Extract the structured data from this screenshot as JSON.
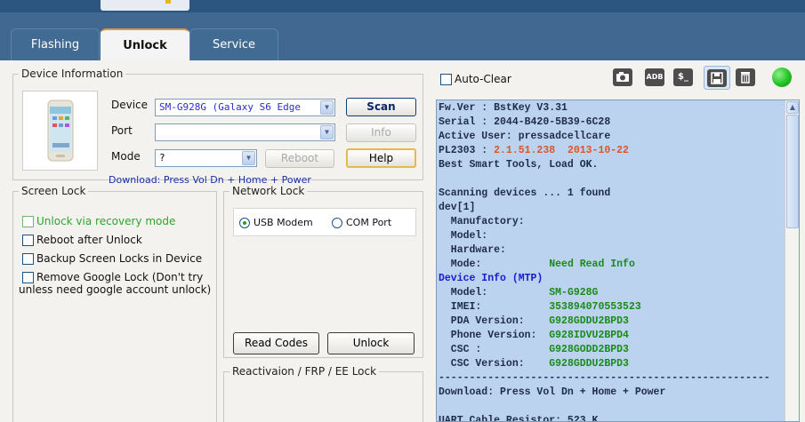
{
  "tabs": [
    {
      "label": "Flashing",
      "active": false
    },
    {
      "label": "Unlock",
      "active": true
    },
    {
      "label": "Service",
      "active": false
    }
  ],
  "device_info": {
    "legend": "Device Information",
    "device_label": "Device",
    "device_value": "SM-G928G  (Galaxy S6 Edge",
    "port_label": "Port",
    "port_value": "",
    "mode_label": "Mode",
    "mode_value": "?",
    "scan_label": "Scan",
    "info_label": "Info",
    "reboot_label": "Reboot",
    "help_label": "Help",
    "download_hint": "Download: Press Vol Dn + Home + Power"
  },
  "screen_lock": {
    "legend": "Screen Lock",
    "options": [
      {
        "label": "Unlock via recovery mode",
        "checked": false,
        "color": "#2ea52e"
      },
      {
        "label": "Reboot after Unlock",
        "checked": false
      },
      {
        "label": "Backup Screen Locks in Device",
        "checked": false
      },
      {
        "label": "Remove Google Lock (Don't try",
        "checked": false
      }
    ],
    "remove_google_note": "unless need google account unlock)"
  },
  "network_lock": {
    "legend": "Network Lock",
    "usb_modem_label": "USB Modem",
    "com_port_label": "COM Port",
    "selected": "USB Modem",
    "read_codes_label": "Read Codes",
    "unlock_label": "Unlock"
  },
  "reactivation": {
    "legend": "Reactivaion / FRP / EE Lock"
  },
  "toolbar": {
    "auto_clear_label": "Auto-Clear",
    "adb_label": "ADB",
    "shell_label": "$_",
    "status_color": "#22c322"
  },
  "log": [
    {
      "text": "Fw.Ver : BstKey V3.31",
      "color": "#1d2d4a"
    },
    {
      "text": "Serial : 2044-B420-5B39-6C28",
      "color": "#1d2d4a"
    },
    {
      "text": "Active User: pressadcellcare",
      "color": "#1d2d4a"
    },
    {
      "text": "PL2303 : ",
      "color": "#1d2d4a",
      "highlight": "2.1.51.238  2013-10-22",
      "highlight_color": "#e0532b"
    },
    {
      "text": "Best Smart Tools, Load OK.",
      "color": "#1d2d4a"
    },
    {
      "text": "",
      "color": "#1d2d4a"
    },
    {
      "text": "Scanning devices ... 1 found",
      "color": "#1d2d4a"
    },
    {
      "text": "dev[1]",
      "color": "#1d2d4a"
    },
    {
      "text": "  Manufactory:",
      "color": "#1d2d4a"
    },
    {
      "text": "  Model:",
      "color": "#1d2d4a"
    },
    {
      "text": "  Hardware:",
      "color": "#1d2d4a"
    },
    {
      "text": "  Mode:           ",
      "color": "#1d2d4a",
      "highlight": "Need Read Info",
      "highlight_color": "#1a8a1a"
    },
    {
      "text": "Device Info (MTP)",
      "color": "#1a1acf"
    },
    {
      "text": "  Model:          ",
      "color": "#1d2d4a",
      "highlight": "SM-G928G",
      "highlight_color": "#1a8a1a"
    },
    {
      "text": "  IMEI:           ",
      "color": "#1d2d4a",
      "highlight": "353894070553523",
      "highlight_color": "#1a8a1a"
    },
    {
      "text": "  PDA Version:    ",
      "color": "#1d2d4a",
      "highlight": "G928GDDU2BPD3",
      "highlight_color": "#1a8a1a"
    },
    {
      "text": "  Phone Version:  ",
      "color": "#1d2d4a",
      "highlight": "G928IDVU2BPD4",
      "highlight_color": "#1a8a1a"
    },
    {
      "text": "  CSC :           ",
      "color": "#1d2d4a",
      "highlight": "G928GODD2BPD3",
      "highlight_color": "#1a8a1a"
    },
    {
      "text": "  CSC Version:    ",
      "color": "#1d2d4a",
      "highlight": "G928GDDU2BPD3",
      "highlight_color": "#1a8a1a"
    },
    {
      "text": "------------------------------------------------------",
      "color": "#1d2d4a"
    },
    {
      "text": "Download: Press Vol Dn + Home + Power",
      "color": "#1d2d4a"
    },
    {
      "text": "",
      "color": "#1d2d4a"
    },
    {
      "text": "UART Cable Resistor: 523 K",
      "color": "#1d2d4a"
    }
  ]
}
